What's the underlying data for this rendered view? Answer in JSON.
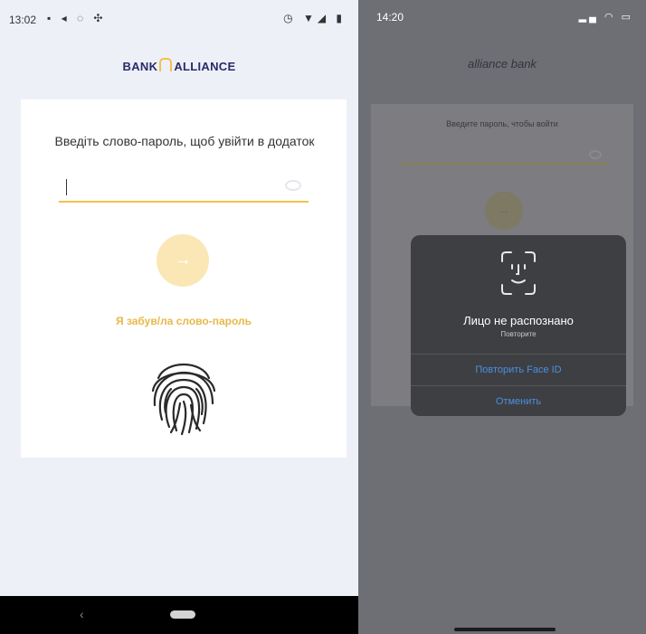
{
  "android": {
    "status": {
      "time": "13:02"
    },
    "logo": {
      "left": "BANK",
      "right": "ALLIANCE"
    },
    "prompt": "Введіть слово-пароль, щоб увійти в додаток",
    "forgot": "Я забув/ла слово-пароль",
    "go_arrow": "→",
    "nav_back": "‹"
  },
  "ios": {
    "status": {
      "time": "14:20"
    },
    "logo": "alliance bank",
    "prompt": "Введите пароль, чтобы войти",
    "go_arrow": "→",
    "dialog": {
      "title": "Лицо не распознано",
      "subtitle": "Повторите",
      "retry": "Повторить Face ID",
      "cancel": "Отменить"
    }
  },
  "colors": {
    "accent_yellow": "#f2c14b",
    "forgot_text": "#e9b84a",
    "ios_link": "#4a90e2",
    "dim_overlay": "#6e6f75"
  },
  "icons": [
    "fingerprint-icon",
    "face-id-icon",
    "eye-icon",
    "arrow-right-icon",
    "back-icon",
    "home-pill-icon",
    "signal-icon",
    "wifi-icon",
    "battery-icon"
  ]
}
